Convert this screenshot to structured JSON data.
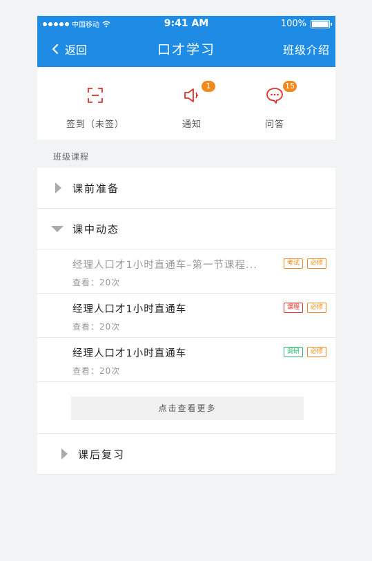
{
  "status_bar": {
    "carrier": "中国移动",
    "time": "9:41 AM",
    "battery": "100%"
  },
  "nav": {
    "back_label": "返回",
    "title": "口才学习",
    "right_label": "班级介绍"
  },
  "quick_actions": [
    {
      "label": "签到（未签）",
      "icon": "scan-icon"
    },
    {
      "label": "通知",
      "icon": "speaker-icon",
      "badge": "1"
    },
    {
      "label": "问答",
      "icon": "chat-bubble-icon",
      "badge": "15"
    }
  ],
  "section_label": "班级课程",
  "groups": {
    "before": {
      "title": "课前准备"
    },
    "during": {
      "title": "课中动态"
    },
    "after": {
      "title": "课后复习"
    }
  },
  "items": [
    {
      "title": "经理人口才1小时直通车–第一节课程...",
      "views": "查看：20次",
      "tags": [
        "考试",
        "必修"
      ]
    },
    {
      "title": "经理人口才1小时直通车",
      "views": "查看：20次",
      "tags": [
        "课程",
        "必修"
      ]
    },
    {
      "title": "经理人口才1小时直通车",
      "views": "查看：20次",
      "tags": [
        "调研",
        "必修"
      ]
    }
  ],
  "more_label": "点击查看更多",
  "colors": {
    "header": "#1e8ce5",
    "accent_red": "#e0302c",
    "badge": "#f08a1c",
    "tag_orange": "#f08a1c",
    "tag_red": "#e0302c",
    "tag_green": "#2bb673"
  }
}
